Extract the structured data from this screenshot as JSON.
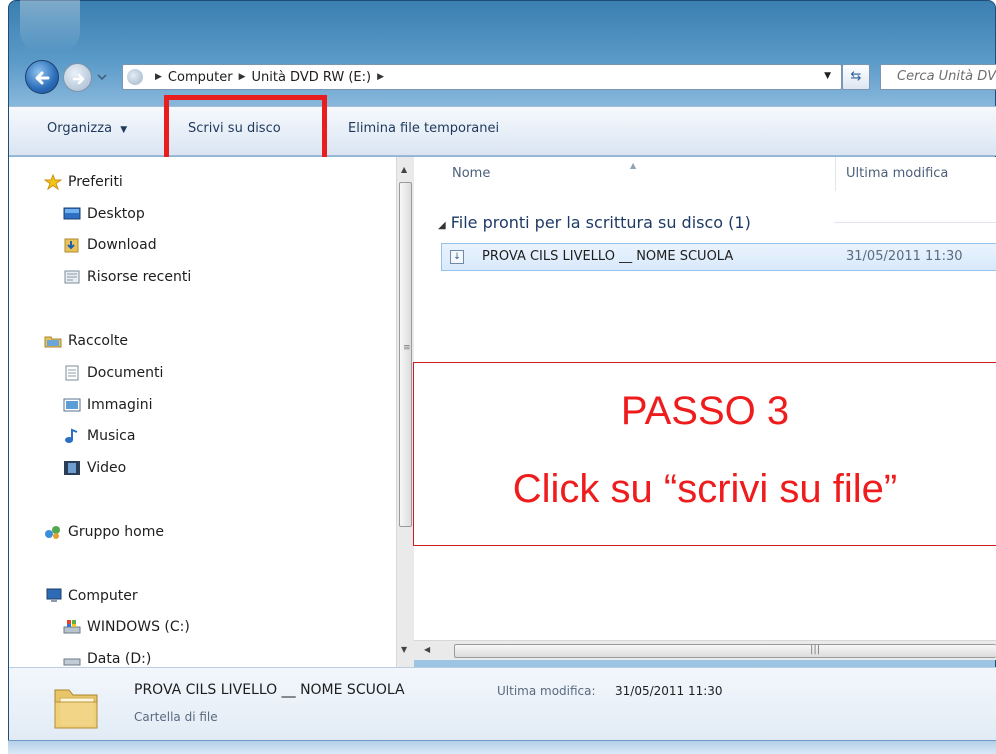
{
  "address": {
    "crumbs": [
      "Computer",
      "Unità DVD RW (E:)"
    ],
    "search_placeholder": "Cerca Unità DVD RW (E:)"
  },
  "toolbar": {
    "organize_label": "Organizza",
    "burn_label": "Scrivi su disco",
    "delete_temp_label": "Elimina file temporanei"
  },
  "sidebar": {
    "favorites": "Preferiti",
    "desktop": "Desktop",
    "download": "Download",
    "recent": "Risorse recenti",
    "libraries": "Raccolte",
    "documents": "Documenti",
    "pictures": "Immagini",
    "music": "Musica",
    "video": "Video",
    "homegroup": "Gruppo home",
    "computer": "Computer",
    "drive_c": "WINDOWS (C:)",
    "drive_d": "Data (D:)"
  },
  "content": {
    "col_name": "Nome",
    "col_modified": "Ultima modifica",
    "group_title": "File pronti per la scrittura su disco (1)",
    "file": {
      "name": "PROVA CILS LIVELLO __ NOME SCUOLA",
      "modified": "31/05/2011 11:30"
    }
  },
  "callout": {
    "line1": "PASSO 3",
    "line2": "Click su “scrivi su file”",
    "color": "#ee1c1c"
  },
  "details": {
    "name": "PROVA CILS LIVELLO __ NOME SCUOLA",
    "modified_label": "Ultima modifica:",
    "modified_value": "31/05/2011 11:30",
    "type": "Cartella di file"
  }
}
